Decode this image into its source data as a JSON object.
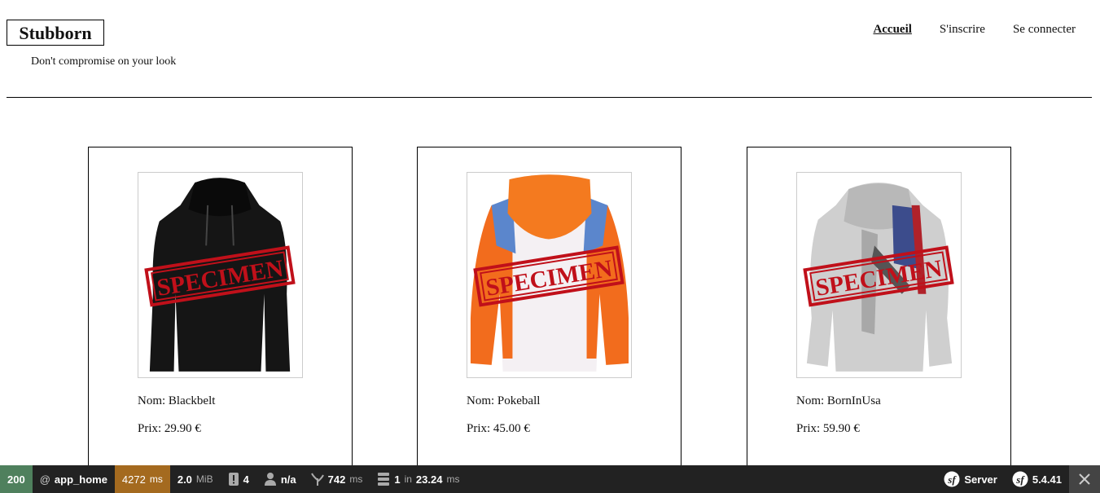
{
  "header": {
    "brand": "Stubborn",
    "tagline": "Don't compromise on your look",
    "nav": [
      {
        "label": "Accueil",
        "active": true
      },
      {
        "label": "S'inscrire",
        "active": false
      },
      {
        "label": "Se connecter",
        "active": false
      }
    ]
  },
  "products": [
    {
      "name": "Nom: Blackbelt",
      "price": "Prix: 29.90 €",
      "image_alt": "black hoodie",
      "watermark": "SPECIMEN"
    },
    {
      "name": "Nom: Pokeball",
      "price": "Prix: 45.00 €",
      "image_alt": "orange white hoodie",
      "watermark": "SPECIMEN"
    },
    {
      "name": "Nom: BornInUsa",
      "price": "Prix: 59.90 €",
      "image_alt": "grey flag hoodie",
      "watermark": "SPECIMEN"
    }
  ],
  "toolbar": {
    "status": "200",
    "route_prefix": "@",
    "route": "app_home",
    "time_value": "4272",
    "time_unit": "ms",
    "memory_value": "2.0",
    "memory_unit": "MiB",
    "logs_count": "4",
    "user": "n/a",
    "render_value": "742",
    "render_unit": "ms",
    "db_count": "1",
    "db_in": "in",
    "db_time": "23.24",
    "db_unit": "ms",
    "server_label": "Server",
    "version": "5.4.41"
  },
  "colors": {
    "status_bg": "#4f805d",
    "time_bg": "#a46a1f",
    "toolbar_bg": "#222222",
    "watermark_red": "#c0101a"
  }
}
